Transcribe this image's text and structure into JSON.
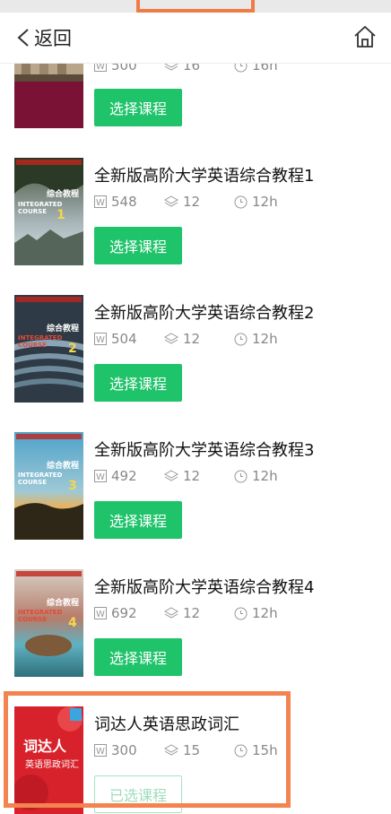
{
  "nav": {
    "back_label": "返回",
    "back_icon": "chevron-left-icon",
    "home_icon": "home-icon"
  },
  "courses": [
    {
      "title": "",
      "words": "500",
      "units": "16",
      "hours": "16h",
      "button": "选择课程"
    },
    {
      "title": "全新版高阶大学英语综合教程1",
      "words": "548",
      "units": "12",
      "hours": "12h",
      "button": "选择课程",
      "cover_text": "综合教程",
      "cover_sub": "INTEGRATED COURSE",
      "cover_num": "1"
    },
    {
      "title": "全新版高阶大学英语综合教程2",
      "words": "504",
      "units": "12",
      "hours": "12h",
      "button": "选择课程",
      "cover_text": "综合教程",
      "cover_sub": "INTEGRATED COURSE",
      "cover_num": "2"
    },
    {
      "title": "全新版高阶大学英语综合教程3",
      "words": "492",
      "units": "12",
      "hours": "12h",
      "button": "选择课程",
      "cover_text": "综合教程",
      "cover_sub": "INTEGRATED COURSE",
      "cover_num": "3"
    },
    {
      "title": "全新版高阶大学英语综合教程4",
      "words": "692",
      "units": "12",
      "hours": "12h",
      "button": "选择课程",
      "cover_text": "综合教程",
      "cover_sub": "INTEGRATED COURSE",
      "cover_num": "4"
    },
    {
      "title": "词达人英语思政词汇",
      "words": "300",
      "units": "15",
      "hours": "15h",
      "button": "已选课程",
      "cover_text": "词达人",
      "cover_sub": "英语思政词汇"
    }
  ],
  "colors": {
    "accent_green": "#1fc36a",
    "highlight_orange": "#f07b45"
  }
}
